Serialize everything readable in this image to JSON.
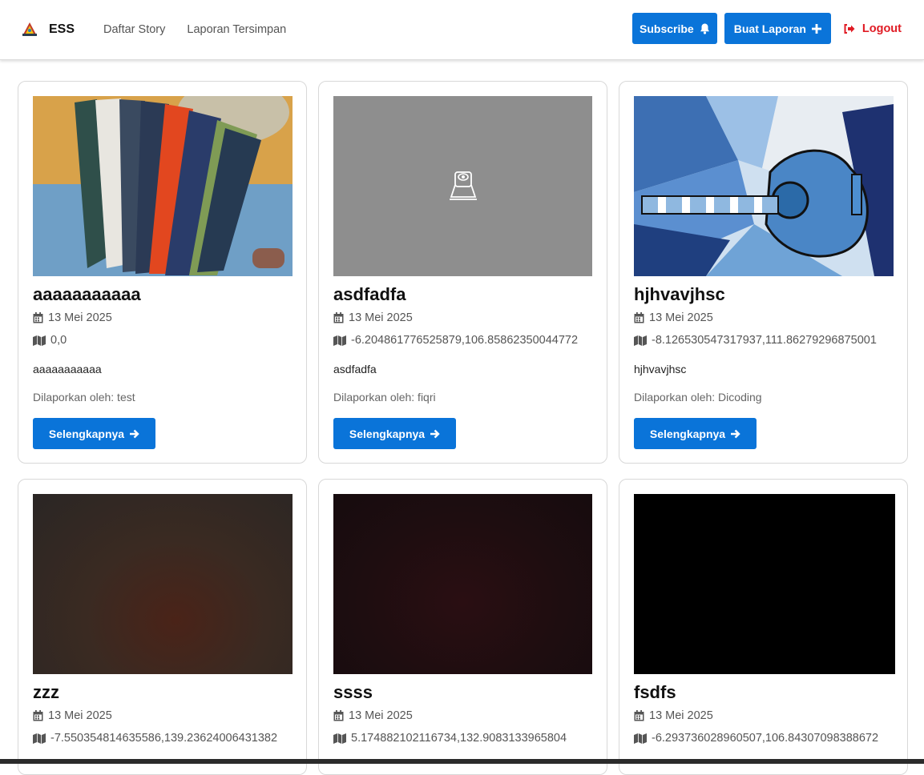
{
  "header": {
    "brand": "ESS",
    "nav": [
      "Daftar Story",
      "Laporan Tersimpan"
    ],
    "subscribe_label": "Subscribe",
    "buat_laporan_label": "Buat Laporan",
    "logout_label": "Logout"
  },
  "colors": {
    "primary": "#0a74d9",
    "logout": "#e01b24"
  },
  "stories": [
    {
      "title": "aaaaaaaaaaa",
      "date": "13 Mei 2025",
      "location": "0,0",
      "description": "aaaaaaaaaaa",
      "reporter": "Dilaporkan oleh: test",
      "button": "Selengkapnya",
      "image": "phone-cases-photo"
    },
    {
      "title": "asdfadfa",
      "date": "13 Mei 2025",
      "location": "-6.204861776525879,106.85862350044772",
      "description": "asdfadfa",
      "reporter": "Dilaporkan oleh: fiqri",
      "button": "Selengkapnya",
      "image": "webcam-placeholder-icon"
    },
    {
      "title": "hjhvavjhsc",
      "date": "13 Mei 2025",
      "location": "-8.126530547317937,111.86279296875001",
      "description": "hjhvavjhsc",
      "reporter": "Dilaporkan oleh: Dicoding",
      "button": "Selengkapnya",
      "image": "blue-guitar-painting"
    },
    {
      "title": "zzz",
      "date": "13 Mei 2025",
      "location": "-7.550354814635586,139.23624006431382",
      "image": "dark-brown-photo"
    },
    {
      "title": "ssss",
      "date": "13 Mei 2025",
      "location": "5.174882102116734,132.9083133965804",
      "image": "dark-red-photo"
    },
    {
      "title": "fsdfs",
      "date": "13 Mei 2025",
      "location": "-6.293736028960507,106.84307098388672",
      "image": "black-photo"
    }
  ]
}
